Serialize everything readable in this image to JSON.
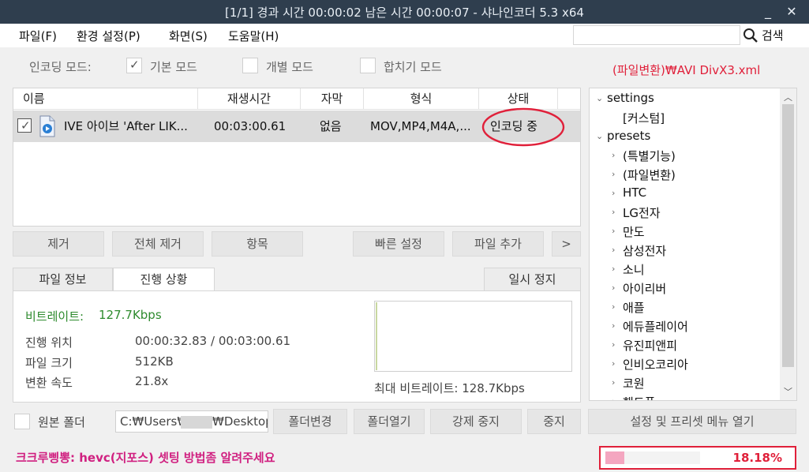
{
  "window": {
    "title": "[1/1] 경과 시간 00:00:02   남은 시간 00:00:07  - 샤나인코더 5.3 x64",
    "minimize_glyph": "_",
    "close_glyph": "✕"
  },
  "menu": {
    "items": [
      "파일(F)",
      "환경 설정(P)",
      "화면(S)",
      "도움말(H)"
    ],
    "search_placeholder": "",
    "search_label": "검색",
    "search_icon": "search-icon"
  },
  "modes": {
    "label": "인코딩 모드:",
    "options": [
      {
        "label": "기본 모드",
        "checked": true
      },
      {
        "label": "개별 모드",
        "checked": false
      },
      {
        "label": "합치기 모드",
        "checked": false
      }
    ],
    "preset_path": "(파일변환)₩AVI DivX3.xml"
  },
  "file_list": {
    "columns": [
      "이름",
      "재생시간",
      "자막",
      "형식",
      "상태"
    ],
    "rows": [
      {
        "checked": true,
        "icon": "media-file-icon",
        "name": "IVE 아이브 'After LIK...",
        "duration": "00:03:00.61",
        "subtitle": "없음",
        "format": "MOV,MP4,M4A,...",
        "status": "인코딩 중"
      }
    ]
  },
  "list_buttons": {
    "remove": "제거",
    "remove_all": "전체 제거",
    "item": "항목",
    "quick_settings": "빠른 설정",
    "add_file": "파일 추가",
    "more": ">"
  },
  "tabs": {
    "file_info": "파일 정보",
    "progress": "진행 상황",
    "pause": "일시 정지"
  },
  "progress": {
    "bitrate_label": "비트레이트:",
    "bitrate_value": "127.7Kbps",
    "position_label": "진행 위치",
    "position_value": "00:00:32.83 / 00:03:00.61",
    "filesize_label": "파일 크기",
    "filesize_value": "512KB",
    "speed_label": "변환 속도",
    "speed_value": "21.8x",
    "max_bitrate": "최대 비트레이트: 128.7Kbps"
  },
  "tree": {
    "items": [
      {
        "label": "settings",
        "level": 0,
        "arrow": "v"
      },
      {
        "label": "[커스텀]",
        "level": 1,
        "arrow": ""
      },
      {
        "label": "presets",
        "level": 0,
        "arrow": "v"
      },
      {
        "label": "(특별기능)",
        "level": 1,
        "arrow": ">"
      },
      {
        "label": "(파일변환)",
        "level": 1,
        "arrow": ">"
      },
      {
        "label": "HTC",
        "level": 1,
        "arrow": ">"
      },
      {
        "label": "LG전자",
        "level": 1,
        "arrow": ">"
      },
      {
        "label": "만도",
        "level": 1,
        "arrow": ">"
      },
      {
        "label": "삼성전자",
        "level": 1,
        "arrow": ">"
      },
      {
        "label": "소니",
        "level": 1,
        "arrow": ">"
      },
      {
        "label": "아이리버",
        "level": 1,
        "arrow": ">"
      },
      {
        "label": "애플",
        "level": 1,
        "arrow": ">"
      },
      {
        "label": "에듀플레이어",
        "level": 1,
        "arrow": ">"
      },
      {
        "label": "유진피앤피",
        "level": 1,
        "arrow": ">"
      },
      {
        "label": "인비오코리아",
        "level": 1,
        "arrow": ">"
      },
      {
        "label": "코원",
        "level": 1,
        "arrow": ">"
      },
      {
        "label": "핸드폰",
        "level": 1,
        "arrow": ">"
      }
    ]
  },
  "output": {
    "source_folder_label": "원본 폴더",
    "path_prefix": "C:₩Users₩",
    "path_suffix": "₩Desktop",
    "change_folder": "폴더변경",
    "open_folder": "폴더열기",
    "force_stop": "강제 중지",
    "stop": "중지",
    "settings_menu": "설정 및 프리셋 메뉴 열기"
  },
  "status": {
    "message": "크크루삥뽕: hevc(지포스) 셋팅 방법좀 알려주세요",
    "progress_percent": "18.18%",
    "progress_fraction": 0.1818
  },
  "colors": {
    "titlebar": "#2f3e4e",
    "accent_red": "#e0203a",
    "magenta": "#d02080",
    "bitrate_green": "#2e8b2e",
    "progress_fill": "#f4a6c0"
  }
}
